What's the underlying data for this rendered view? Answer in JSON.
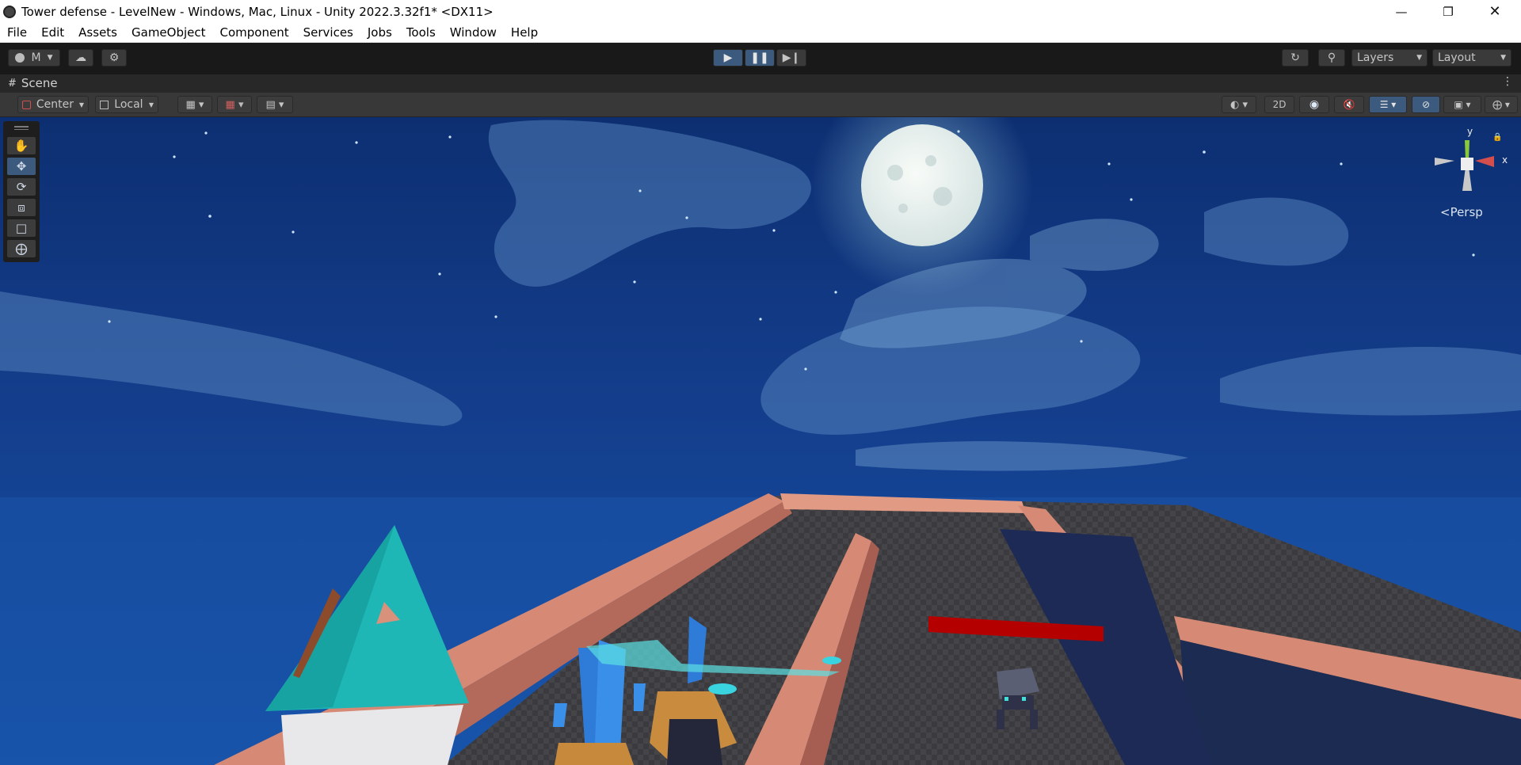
{
  "window": {
    "title": "Tower defense - LevelNew - Windows, Mac, Linux - Unity 2022.3.32f1* <DX11>",
    "minimize_icon": "minimize-icon",
    "maximize_icon": "restore-icon",
    "close_icon": "close-icon"
  },
  "menu": [
    "File",
    "Edit",
    "Assets",
    "GameObject",
    "Component",
    "Services",
    "Jobs",
    "Tools",
    "Window",
    "Help"
  ],
  "toolbar": {
    "account_label": "M",
    "play_icon": "play-icon",
    "pause_icon": "pause-icon",
    "step_icon": "step-icon",
    "layers_label": "Layers",
    "layout_label": "Layout"
  },
  "scene_tab": {
    "label": "Scene"
  },
  "scene_toolbar": {
    "pivot_label": "Center",
    "space_label": "Local",
    "mode_2d_label": "2D"
  },
  "tools": [
    "hand-tool",
    "move-tool",
    "rotate-tool",
    "scale-tool",
    "rect-tool",
    "transform-tool"
  ],
  "active_tool": "move-tool",
  "gizmo": {
    "y_label": "y",
    "x_label": "x",
    "projection_label": "<Persp"
  },
  "colors": {
    "accent": "#3b5a7d",
    "sky": "#123f8a",
    "moon": "#e9f2ef",
    "turret": "#1fb7b6",
    "wall": "#d78a76",
    "health_bar": "#b50000"
  }
}
